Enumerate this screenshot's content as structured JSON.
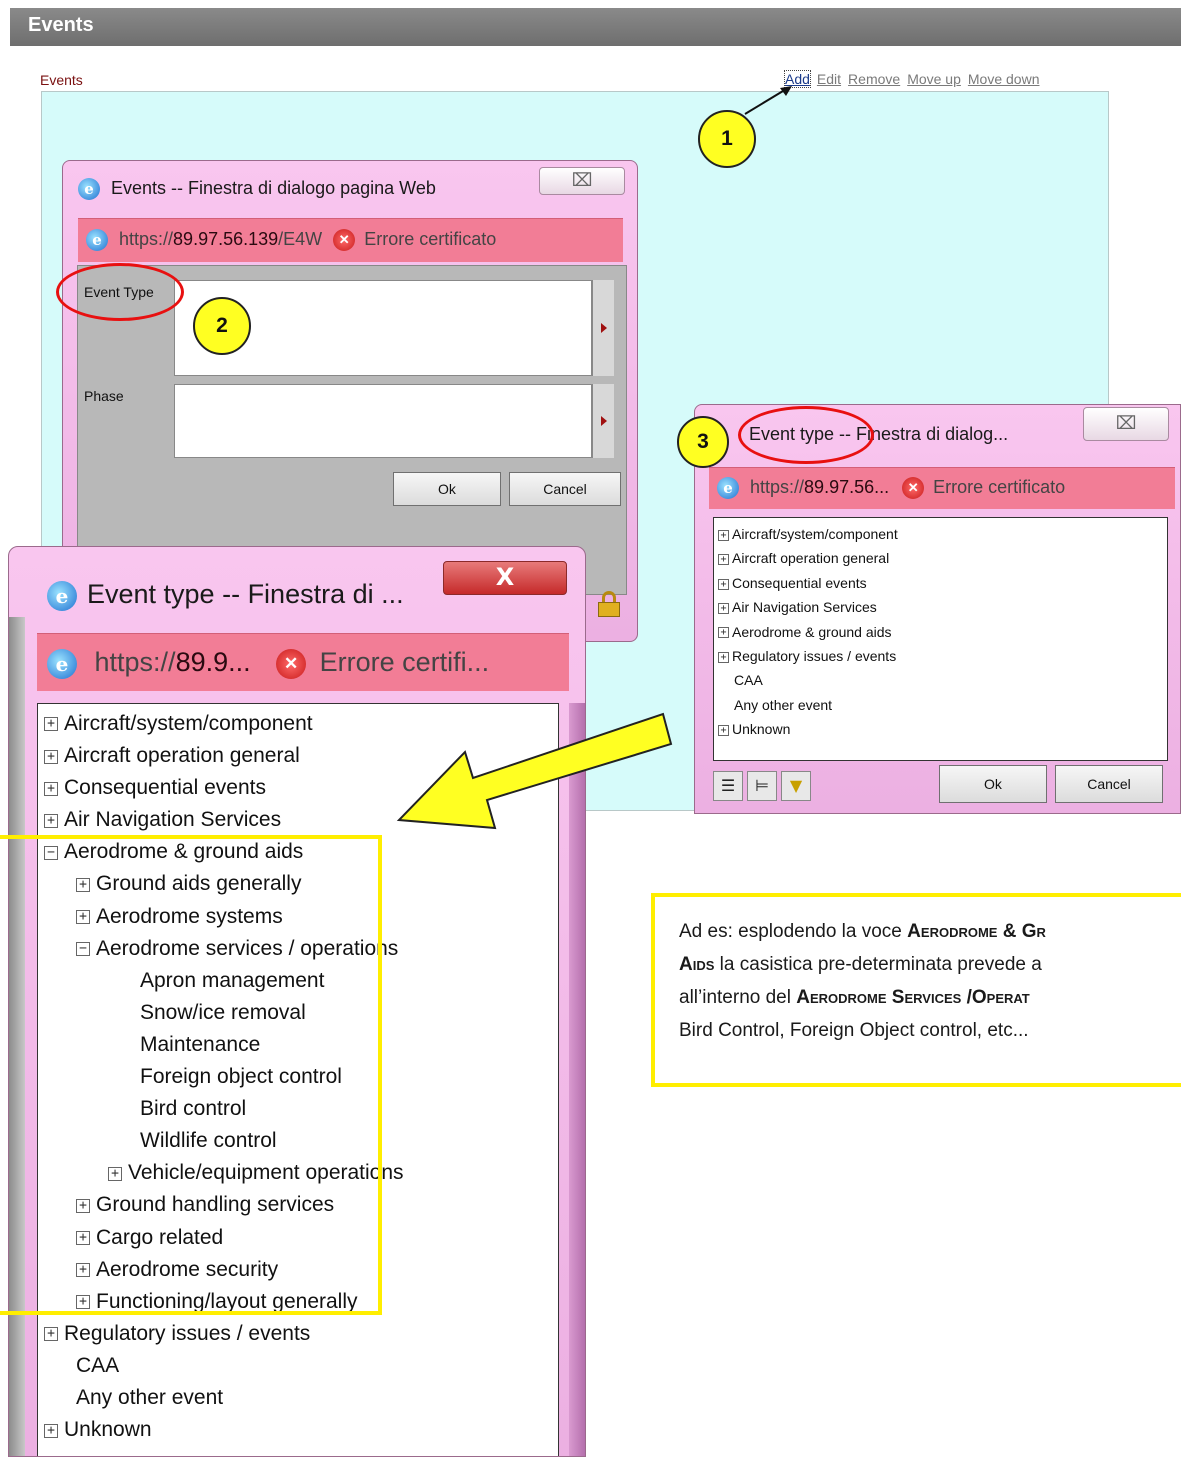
{
  "header": {
    "title": "Events"
  },
  "events_panel": {
    "label": "Events",
    "actions": [
      "Add",
      "Edit",
      "Remove",
      "Move up",
      "Move down"
    ]
  },
  "dialog_events": {
    "title": "Events -- Finestra di dialogo pagina Web",
    "close_glyph": "⌧",
    "url_prefix": "https://",
    "url_host": "89.97.56.139",
    "url_rest": "/E4W",
    "cert_error": "Errore certificato",
    "fields": [
      {
        "label": "Event Type",
        "value": ""
      },
      {
        "label": "Phase",
        "value": ""
      }
    ],
    "ok": "Ok",
    "cancel": "Cancel"
  },
  "dialog_event_type_small": {
    "title": "Event type -- Finestra di dialog...",
    "url_prefix": "https://",
    "url_host": "89.97.56...",
    "cert_error": "Errore certificato",
    "tree": [
      {
        "label": "Aircraft/system/component",
        "expander": "+"
      },
      {
        "label": "Aircraft operation general",
        "expander": "+"
      },
      {
        "label": "Consequential events",
        "expander": "+"
      },
      {
        "label": "Air Navigation Services",
        "expander": "+"
      },
      {
        "label": "Aerodrome & ground aids",
        "expander": "+"
      },
      {
        "label": "Regulatory issues / events",
        "expander": "+"
      },
      {
        "label": "CAA",
        "expander": ""
      },
      {
        "label": "Any other event",
        "expander": ""
      },
      {
        "label": "Unknown",
        "expander": "+"
      }
    ],
    "toolbar_icons": [
      "list-icon",
      "tree-icon",
      "filter-icon"
    ],
    "ok": "Ok",
    "cancel": "Cancel"
  },
  "dialog_event_type_large": {
    "title": "Event type -- Finestra di ...",
    "url_prefix": "https://",
    "url_host": "89.9...",
    "cert_error": "Errore certifi...",
    "tree": [
      {
        "label": "Aircraft/system/component",
        "expander": "+",
        "level": 0
      },
      {
        "label": "Aircraft operation general",
        "expander": "+",
        "level": 0
      },
      {
        "label": "Consequential events",
        "expander": "+",
        "level": 0
      },
      {
        "label": "Air Navigation Services",
        "expander": "+",
        "level": 0
      },
      {
        "label": "Aerodrome & ground aids",
        "expander": "−",
        "level": 0
      },
      {
        "label": "Ground aids generally",
        "expander": "+",
        "level": 1
      },
      {
        "label": "Aerodrome systems",
        "expander": "+",
        "level": 1
      },
      {
        "label": "Aerodrome services / operations",
        "expander": "−",
        "level": 1
      },
      {
        "label": "Apron management",
        "expander": "",
        "level": 2
      },
      {
        "label": "Snow/ice removal",
        "expander": "",
        "level": 2
      },
      {
        "label": "Maintenance",
        "expander": "",
        "level": 2
      },
      {
        "label": "Foreign object control",
        "expander": "",
        "level": 2
      },
      {
        "label": "Bird control",
        "expander": "",
        "level": 2
      },
      {
        "label": "Wildlife control",
        "expander": "",
        "level": 2
      },
      {
        "label": "Vehicle/equipment operations",
        "expander": "+",
        "level": 2
      },
      {
        "label": "Ground handling services",
        "expander": "+",
        "level": 1
      },
      {
        "label": "Cargo related",
        "expander": "+",
        "level": 1
      },
      {
        "label": "Aerodrome security",
        "expander": "+",
        "level": 1
      },
      {
        "label": "Functioning/layout generally",
        "expander": "+",
        "level": 1
      },
      {
        "label": "Regulatory issues / events",
        "expander": "+",
        "level": 0
      },
      {
        "label": "CAA",
        "expander": "",
        "level": 0
      },
      {
        "label": "Any other event",
        "expander": "",
        "level": 0
      },
      {
        "label": "Unknown",
        "expander": "+",
        "level": 0
      }
    ]
  },
  "callouts": [
    "1",
    "2",
    "3"
  ],
  "note": {
    "line1_a": "Ad es: esplodendo la voce ",
    "line1_b": "Aerodrome & Gr",
    "line2_a": "Aids",
    "line2_b": " la casistica pre-determinata prevede a",
    "line3_a": "all’interno del ",
    "line3_b": "Aerodrome Services /Operat",
    "line4": "Bird Control, Foreign Object control, etc..."
  },
  "colors": {
    "highlight_yellow": "#ffee00",
    "callout_red": "#e81010",
    "window_pink": "#f9c6ef",
    "address_bar": "#f27d96",
    "panel_cyan": "#d6fbfa"
  }
}
